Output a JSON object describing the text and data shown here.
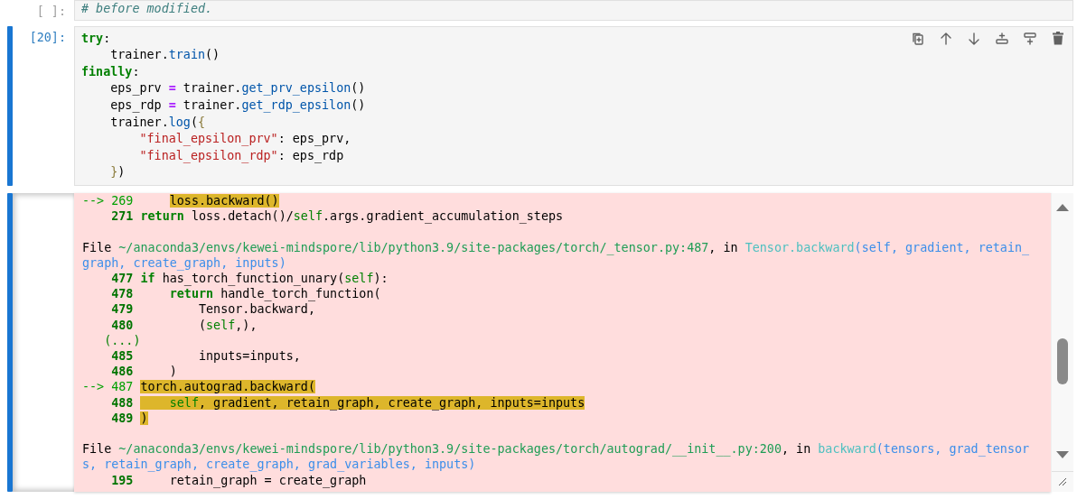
{
  "cells": [
    {
      "prompt": "[ ]:",
      "selected": false,
      "lines": [
        [
          {
            "kind": "comment",
            "text": "# before modified."
          }
        ]
      ]
    },
    {
      "prompt": "[20]:",
      "selected": true,
      "lines": [
        [
          {
            "kind": "kw",
            "text": "try"
          },
          {
            "kind": "name",
            "text": ":"
          }
        ],
        [
          {
            "kind": "name",
            "text": "    trainer."
          },
          {
            "kind": "call",
            "text": "train"
          },
          {
            "kind": "name",
            "text": "()"
          }
        ],
        [
          {
            "kind": "kw",
            "text": "finally"
          },
          {
            "kind": "name",
            "text": ":"
          }
        ],
        [
          {
            "kind": "name",
            "text": "    eps_prv "
          },
          {
            "kind": "op",
            "text": "="
          },
          {
            "kind": "name",
            "text": " trainer."
          },
          {
            "kind": "call",
            "text": "get_prv_epsilon"
          },
          {
            "kind": "name",
            "text": "()"
          }
        ],
        [
          {
            "kind": "name",
            "text": "    eps_rdp "
          },
          {
            "kind": "op",
            "text": "="
          },
          {
            "kind": "name",
            "text": " trainer."
          },
          {
            "kind": "call",
            "text": "get_rdp_epsilon"
          },
          {
            "kind": "name",
            "text": "()"
          }
        ],
        [
          {
            "kind": "name",
            "text": "    trainer."
          },
          {
            "kind": "call",
            "text": "log"
          },
          {
            "kind": "name",
            "text": "("
          },
          {
            "kind": "brace",
            "text": "{"
          }
        ],
        [
          {
            "kind": "str",
            "text": "        \"final_epsilon_prv\""
          },
          {
            "kind": "name",
            "text": ": eps_prv,"
          }
        ],
        [
          {
            "kind": "str",
            "text": "        \"final_epsilon_rdp\""
          },
          {
            "kind": "name",
            "text": ": eps_rdp"
          }
        ],
        [
          {
            "kind": "brace",
            "text": "    }"
          },
          {
            "kind": "name",
            "text": ")"
          }
        ]
      ],
      "output": {
        "lines": [
          {
            "kind": "frame",
            "gutter": "--> 269",
            "current": true,
            "highlight": true,
            "highlight_indent": false,
            "tokens": [
              {
                "kind": "name",
                "text": "    loss.backward()"
              }
            ]
          },
          {
            "kind": "frame",
            "gutter": "271",
            "current": false,
            "highlight": false,
            "tokens": [
              {
                "kind": "kw",
                "text": "return"
              },
              {
                "kind": "name",
                "text": " loss.detach()/"
              },
              {
                "kind": "builtin",
                "text": "self"
              },
              {
                "kind": "name",
                "text": ".args.gradient_accumulation_steps"
              }
            ]
          },
          {
            "kind": "blank"
          },
          {
            "kind": "file",
            "tokens": [
              {
                "kind": "name",
                "text": "File "
              },
              {
                "kind": "path",
                "text": "~/anaconda3/envs/kewei-mindspore/lib/python3.9/site-packages/torch/_tensor.py:487"
              },
              {
                "kind": "name",
                "text": ", in "
              },
              {
                "kind": "func",
                "text": "Tensor.backward"
              },
              {
                "kind": "args",
                "text": "(self, gradient, retain_graph, create_graph, inputs)"
              }
            ]
          },
          {
            "kind": "frame",
            "gutter": "477",
            "current": false,
            "highlight": false,
            "tokens": [
              {
                "kind": "kw",
                "text": "if"
              },
              {
                "kind": "name",
                "text": " has_torch_function_unary("
              },
              {
                "kind": "builtin",
                "text": "self"
              },
              {
                "kind": "name",
                "text": "):"
              }
            ]
          },
          {
            "kind": "frame",
            "gutter": "478",
            "current": false,
            "highlight": false,
            "tokens": [
              {
                "kind": "kw",
                "text": "    return"
              },
              {
                "kind": "name",
                "text": " handle_torch_function("
              }
            ]
          },
          {
            "kind": "frame",
            "gutter": "479",
            "current": false,
            "highlight": false,
            "tokens": [
              {
                "kind": "name",
                "text": "        Tensor.backward,"
              }
            ]
          },
          {
            "kind": "frame",
            "gutter": "480",
            "current": false,
            "highlight": false,
            "tokens": [
              {
                "kind": "name",
                "text": "        ("
              },
              {
                "kind": "builtin",
                "text": "self"
              },
              {
                "kind": "name",
                "text": ",),"
              }
            ]
          },
          {
            "kind": "skip",
            "text": "(...)"
          },
          {
            "kind": "frame",
            "gutter": "485",
            "current": false,
            "highlight": false,
            "tokens": [
              {
                "kind": "name",
                "text": "        inputs=inputs,"
              }
            ]
          },
          {
            "kind": "frame",
            "gutter": "486",
            "current": false,
            "highlight": false,
            "tokens": [
              {
                "kind": "name",
                "text": "    )"
              }
            ]
          },
          {
            "kind": "frame",
            "gutter": "--> 487",
            "current": true,
            "highlight": true,
            "tokens": [
              {
                "kind": "name",
                "text": "torch.autograd.backward("
              }
            ]
          },
          {
            "kind": "frame",
            "gutter": "488",
            "current": false,
            "highlight": true,
            "highlight_indent": true,
            "tokens": [
              {
                "kind": "builtin",
                "text": "    self"
              },
              {
                "kind": "name",
                "text": ", gradient, retain_graph, create_graph, inputs=inputs"
              }
            ]
          },
          {
            "kind": "frame",
            "gutter": "489",
            "current": false,
            "highlight": true,
            "tokens": [
              {
                "kind": "name",
                "text": ")"
              }
            ]
          },
          {
            "kind": "blank"
          },
          {
            "kind": "file",
            "tokens": [
              {
                "kind": "name",
                "text": "File "
              },
              {
                "kind": "path",
                "text": "~/anaconda3/envs/kewei-mindspore/lib/python3.9/site-packages/torch/autograd/__init__.py:200"
              },
              {
                "kind": "name",
                "text": ", in "
              },
              {
                "kind": "func",
                "text": "backward"
              },
              {
                "kind": "args",
                "text": "(tensors, grad_tensors, retain_graph, create_graph, grad_variables, inputs)"
              }
            ]
          },
          {
            "kind": "frame",
            "gutter": "195",
            "current": false,
            "highlight": false,
            "tokens": [
              {
                "kind": "name",
                "text": "    retain_graph = create_graph"
              }
            ]
          }
        ]
      }
    }
  ]
}
